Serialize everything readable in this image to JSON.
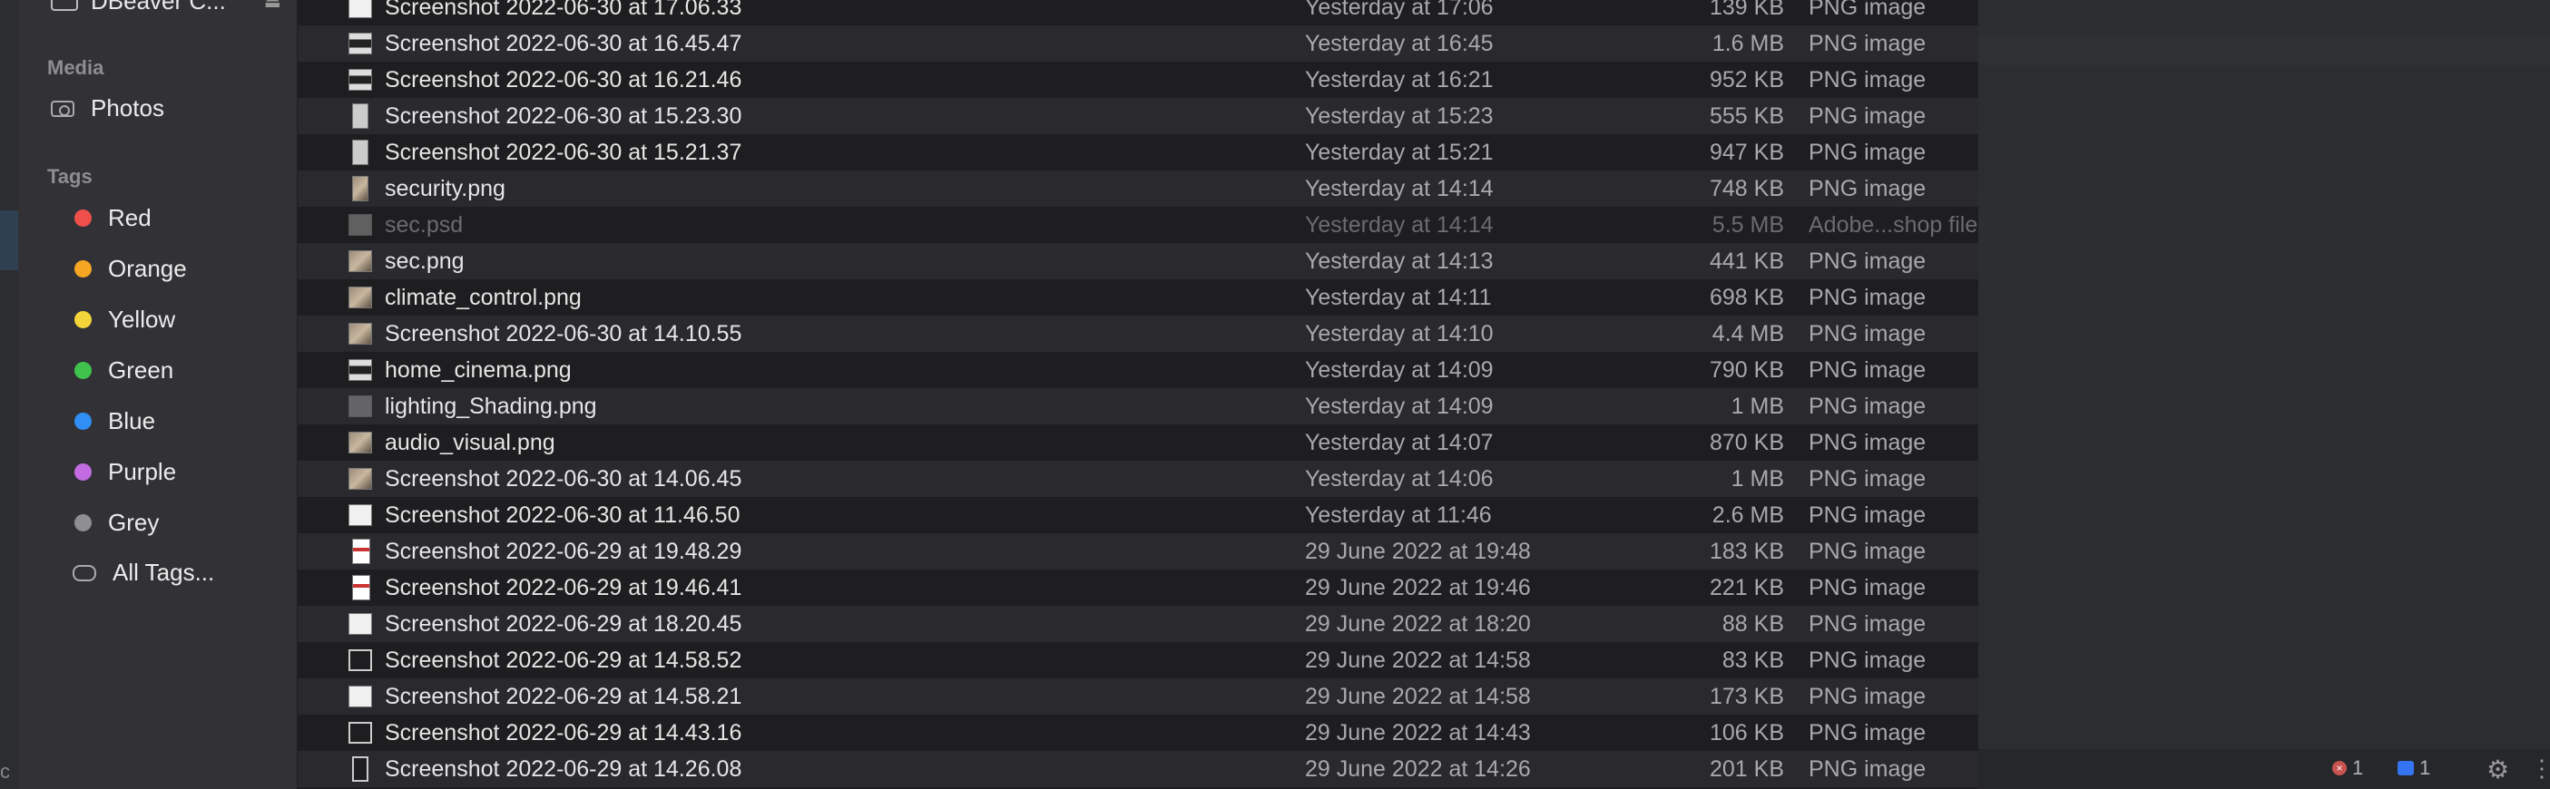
{
  "sidebar": {
    "top_item": "DBeaver C...",
    "media_heading": "Media",
    "photos": "Photos",
    "tags_heading": "Tags",
    "tags": [
      {
        "label": "Red",
        "color": "#ee4f4b"
      },
      {
        "label": "Orange",
        "color": "#f5a623"
      },
      {
        "label": "Yellow",
        "color": "#f3d53b"
      },
      {
        "label": "Green",
        "color": "#3fc34c"
      },
      {
        "label": "Blue",
        "color": "#2f8ff5"
      },
      {
        "label": "Purple",
        "color": "#c36be0"
      },
      {
        "label": "Grey",
        "color": "#8e8e93"
      }
    ],
    "all_tags": "All Tags..."
  },
  "files": [
    {
      "name": "Screenshot 2022-06-30 at 17.06.33",
      "date": "Yesterday at 17:06",
      "size": "139 KB",
      "kind": "PNG image"
    },
    {
      "name": "Screenshot 2022-06-30 at 16.45.47",
      "date": "Yesterday at 16:45",
      "size": "1.6 MB",
      "kind": "PNG image"
    },
    {
      "name": "Screenshot 2022-06-30 at 16.21.46",
      "date": "Yesterday at 16:21",
      "size": "952 KB",
      "kind": "PNG image"
    },
    {
      "name": "Screenshot 2022-06-30 at 15.23.30",
      "date": "Yesterday at 15:23",
      "size": "555 KB",
      "kind": "PNG image"
    },
    {
      "name": "Screenshot 2022-06-30 at 15.21.37",
      "date": "Yesterday at 15:21",
      "size": "947 KB",
      "kind": "PNG image"
    },
    {
      "name": "security.png",
      "date": "Yesterday at 14:14",
      "size": "748 KB",
      "kind": "PNG image"
    },
    {
      "name": "sec.psd",
      "date": "Yesterday at 14:14",
      "size": "5.5 MB",
      "kind": "Adobe...shop file"
    },
    {
      "name": "sec.png",
      "date": "Yesterday at 14:13",
      "size": "441 KB",
      "kind": "PNG image"
    },
    {
      "name": "climate_control.png",
      "date": "Yesterday at 14:11",
      "size": "698 KB",
      "kind": "PNG image"
    },
    {
      "name": "Screenshot 2022-06-30 at 14.10.55",
      "date": "Yesterday at 14:10",
      "size": "4.4 MB",
      "kind": "PNG image"
    },
    {
      "name": "home_cinema.png",
      "date": "Yesterday at 14:09",
      "size": "790 KB",
      "kind": "PNG image"
    },
    {
      "name": "lighting_Shading.png",
      "date": "Yesterday at 14:09",
      "size": "1 MB",
      "kind": "PNG image"
    },
    {
      "name": "audio_visual.png",
      "date": "Yesterday at 14:07",
      "size": "870 KB",
      "kind": "PNG image"
    },
    {
      "name": "Screenshot 2022-06-30 at 14.06.45",
      "date": "Yesterday at 14:06",
      "size": "1 MB",
      "kind": "PNG image"
    },
    {
      "name": "Screenshot 2022-06-30 at 11.46.50",
      "date": "Yesterday at 11:46",
      "size": "2.6 MB",
      "kind": "PNG image"
    },
    {
      "name": "Screenshot 2022-06-29 at 19.48.29",
      "date": "29 June 2022 at 19:48",
      "size": "183 KB",
      "kind": "PNG image"
    },
    {
      "name": "Screenshot 2022-06-29 at 19.46.41",
      "date": "29 June 2022 at 19:46",
      "size": "221 KB",
      "kind": "PNG image"
    },
    {
      "name": "Screenshot 2022-06-29 at 18.20.45",
      "date": "29 June 2022 at 18:20",
      "size": "88 KB",
      "kind": "PNG image"
    },
    {
      "name": "Screenshot 2022-06-29 at 14.58.52",
      "date": "29 June 2022 at 14:58",
      "size": "83 KB",
      "kind": "PNG image"
    },
    {
      "name": "Screenshot 2022-06-29 at 14.58.21",
      "date": "29 June 2022 at 14:58",
      "size": "173 KB",
      "kind": "PNG image"
    },
    {
      "name": "Screenshot 2022-06-29 at 14.43.16",
      "date": "29 June 2022 at 14:43",
      "size": "106 KB",
      "kind": "PNG image"
    },
    {
      "name": "Screenshot 2022-06-29 at 14.26.08",
      "date": "29 June 2022 at 14:26",
      "size": "201 KB",
      "kind": "PNG image"
    }
  ],
  "statusbar": {
    "error_count": "1",
    "message_count": "1"
  }
}
